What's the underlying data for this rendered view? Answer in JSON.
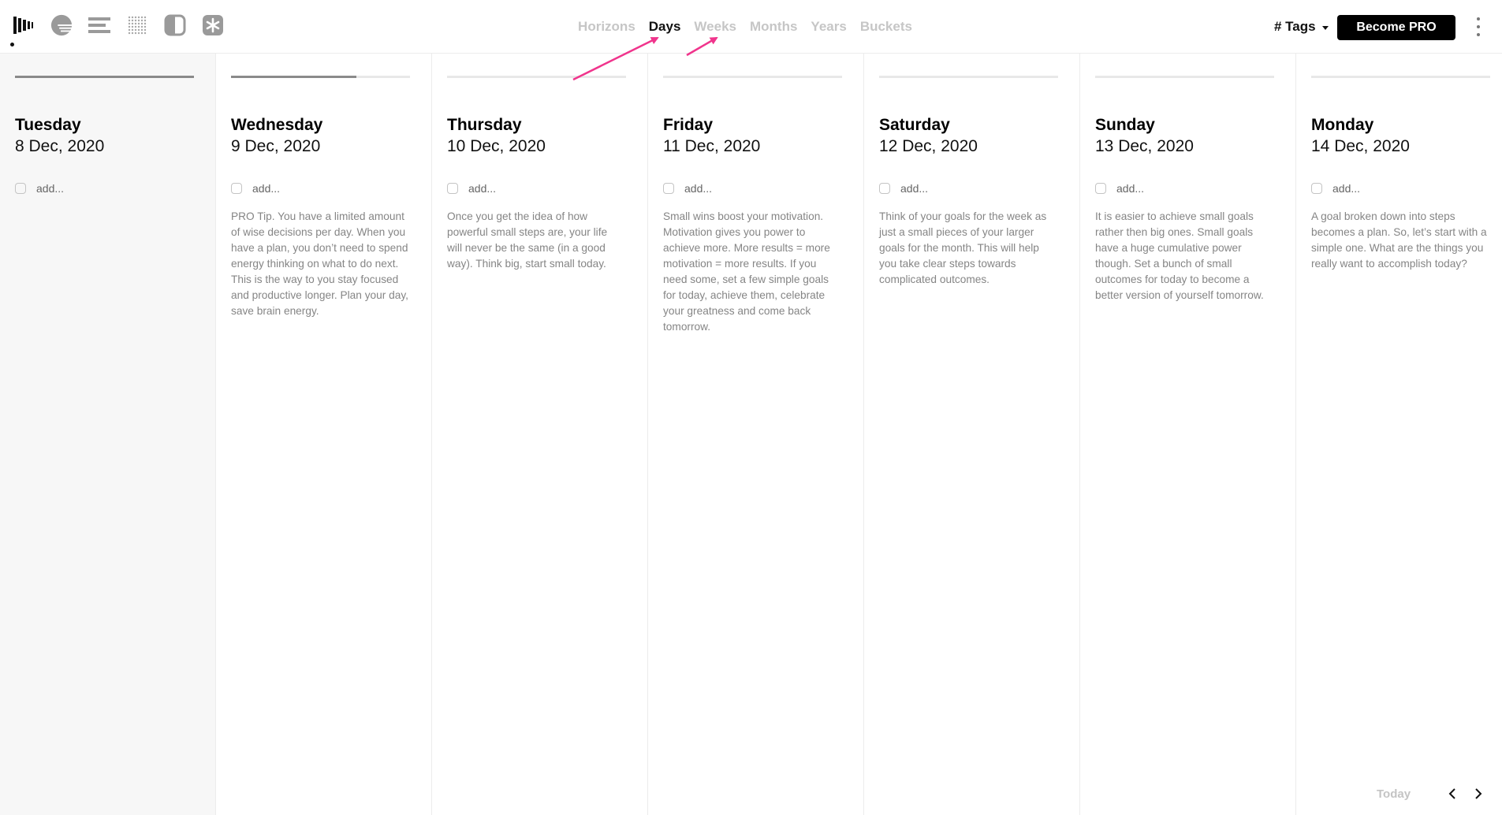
{
  "app_icons": [
    {
      "name": "columns-icon",
      "active": true
    },
    {
      "name": "sunset-icon",
      "active": false
    },
    {
      "name": "lines-icon",
      "active": false
    },
    {
      "name": "dots-grid-icon",
      "active": false
    },
    {
      "name": "half-circle-icon",
      "active": false
    },
    {
      "name": "asterisk-icon",
      "active": false
    }
  ],
  "tabs": [
    {
      "label": "Horizons",
      "active": false
    },
    {
      "label": "Days",
      "active": true
    },
    {
      "label": "Weeks",
      "active": false
    },
    {
      "label": "Months",
      "active": false
    },
    {
      "label": "Years",
      "active": false
    },
    {
      "label": "Buckets",
      "active": false
    }
  ],
  "header": {
    "tags_label": "# Tags",
    "pro_label": "Become PRO"
  },
  "colors": {
    "accent_arrow": "#f0348c",
    "active_text": "#111111",
    "inactive_text": "#c6c6c6",
    "today_column_bg": "#f7f7f7"
  },
  "days": [
    {
      "name": "Tuesday",
      "date": "8 Dec, 2020",
      "add_label": "add...",
      "progress": 1.0,
      "today": true,
      "tip": ""
    },
    {
      "name": "Wednesday",
      "date": "9 Dec, 2020",
      "add_label": "add...",
      "progress": 0.7,
      "today": false,
      "tip": "PRO Tip. You have a limited amount of wise decisions per day. When you have a plan, you don’t need to spend energy thinking on what to do next. This is the way to you stay focused and productive longer. Plan your day, save brain energy."
    },
    {
      "name": "Thursday",
      "date": "10 Dec, 2020",
      "add_label": "add...",
      "progress": 0.0,
      "today": false,
      "tip": "Once you get the idea of how powerful small steps are, your life will never be the same (in a good way). Think big, start small today."
    },
    {
      "name": "Friday",
      "date": "11 Dec, 2020",
      "add_label": "add...",
      "progress": 0.0,
      "today": false,
      "tip": "Small wins boost your motivation. Motivation gives you power to achieve more. More results = more motivation = more results. If you need some, set a few simple goals for today, achieve them, celebrate your greatness and come back tomorrow."
    },
    {
      "name": "Saturday",
      "date": "12 Dec, 2020",
      "add_label": "add...",
      "progress": 0.0,
      "today": false,
      "tip": "Think of your goals for the week as just a small pieces of your larger goals for the month. This will help you take clear steps towards complicated outcomes."
    },
    {
      "name": "Sunday",
      "date": "13 Dec, 2020",
      "add_label": "add...",
      "progress": 0.0,
      "today": false,
      "tip": "It is easier to achieve small goals rather then big ones. Small goals have a huge cumulative power though. Set a bunch of small outcomes for today to become a better version of yourself tomorrow."
    },
    {
      "name": "Monday",
      "date": "14 Dec, 2020",
      "add_label": "add...",
      "progress": 0.0,
      "today": false,
      "tip": "A goal broken down into steps becomes a plan. So, let’s start with a simple one. What are the things you really want to accomplish today?"
    }
  ],
  "footer": {
    "today_label": "Today"
  }
}
